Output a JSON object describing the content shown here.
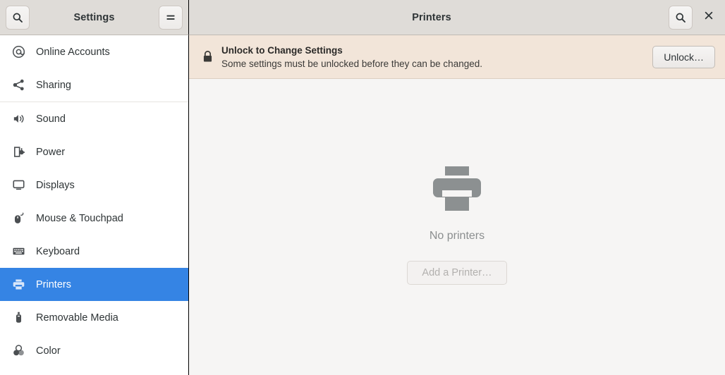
{
  "window": {
    "sidebar_title": "Settings",
    "main_title": "Printers"
  },
  "titlebar": {
    "sidebar_search_icon": "search-icon",
    "menu_icon": "hamburger-menu-icon",
    "main_search_icon": "search-icon",
    "close_icon": "close-icon"
  },
  "sidebar": {
    "groups": [
      {
        "items": [
          {
            "label": "Online Accounts",
            "icon": "at-sign-icon",
            "selected": false
          },
          {
            "label": "Sharing",
            "icon": "share-nodes-icon",
            "selected": false
          }
        ]
      },
      {
        "items": [
          {
            "label": "Sound",
            "icon": "speaker-volume-icon",
            "selected": false
          },
          {
            "label": "Power",
            "icon": "battery-power-icon",
            "selected": false
          },
          {
            "label": "Displays",
            "icon": "monitor-display-icon",
            "selected": false
          },
          {
            "label": "Mouse & Touchpad",
            "icon": "mouse-icon",
            "selected": false
          },
          {
            "label": "Keyboard",
            "icon": "keyboard-icon",
            "selected": false
          },
          {
            "label": "Printers",
            "icon": "printer-icon",
            "selected": true
          },
          {
            "label": "Removable Media",
            "icon": "usb-drive-icon",
            "selected": false
          },
          {
            "label": "Color",
            "icon": "color-circles-icon",
            "selected": false
          }
        ]
      }
    ]
  },
  "infobar": {
    "icon": "lock-icon",
    "title": "Unlock to Change Settings",
    "subtitle": "Some settings must be unlocked before they can be changed.",
    "button_label": "Unlock…"
  },
  "empty_state": {
    "icon": "printer-large-icon",
    "message": "No printers",
    "button_label": "Add a Printer…"
  },
  "colors": {
    "accent": "#3584e4",
    "headerbar": "#dfdcd8",
    "sidebar_bg": "#ffffff",
    "content_bg": "#f6f5f4",
    "infobar_bg": "#f2e5d9",
    "empty_icon": "#8c9091"
  }
}
